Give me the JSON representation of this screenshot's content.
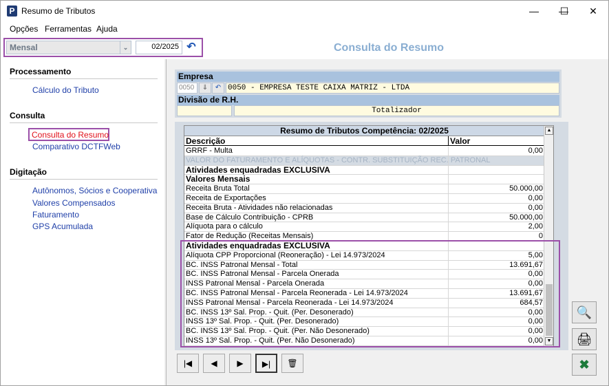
{
  "window": {
    "title": "Resumo de Tributos",
    "icon": "app-p-icon"
  },
  "window_controls": {
    "minimize": "—",
    "maximize": "☐",
    "close": "✕"
  },
  "menu": [
    {
      "label": "Opções",
      "accel": "O"
    },
    {
      "label": "Ferramentas",
      "accel": "F"
    },
    {
      "label": "Ajuda",
      "accel": "A"
    }
  ],
  "toolbar": {
    "period_value": "Mensal",
    "period_arrow": "⌄",
    "date_value": "02/2025",
    "refresh_icon": "↶",
    "page_header": "Consulta do Resumo"
  },
  "sidebar": {
    "sections": [
      {
        "title": "Processamento",
        "items": [
          "Cálculo do Tributo"
        ]
      },
      {
        "title": "Consulta",
        "items": [
          "Consulta do Resumo",
          "Comparativo DCTFWeb"
        ]
      },
      {
        "title": "Digitação",
        "items": [
          "Autônomos, Sócios e Cooperativa",
          "Valores Compensados",
          "Faturamento",
          "GPS Acumulada"
        ]
      }
    ],
    "active_item": "Consulta do Resumo"
  },
  "company": {
    "header": "Empresa",
    "code": "0050",
    "name": "0050 - EMPRESA TESTE CAIXA MATRIZ -  LTDA",
    "division_header": "Divisão de R.H.",
    "division_code": "",
    "division_name": "Totalizador"
  },
  "grid": {
    "title": "Resumo de Tributos Competência: 02/2025",
    "col_desc": "Descrição",
    "col_value": "Valor",
    "rows": [
      {
        "d": "GRRF - Multa",
        "v": "0,00",
        "style": ""
      },
      {
        "d": "VALOR DO FATURAMENTO E ALÍQUOTAS - CONTR. SUBSTITUIÇÃO REC. PATRONAL",
        "v": "",
        "style": "disabled"
      },
      {
        "d": "Atividades enquadradas EXCLUSIVA",
        "v": "",
        "style": "bold"
      },
      {
        "d": "Valores Mensais",
        "v": "",
        "style": "bold"
      },
      {
        "d": "Receita Bruta Total",
        "v": "50.000,00",
        "style": ""
      },
      {
        "d": "Receita de Exportações",
        "v": "0,00",
        "style": ""
      },
      {
        "d": "Receita Bruta - Atividades não relacionadas",
        "v": "0,00",
        "style": ""
      },
      {
        "d": "Base de Cálculo Contribuição - CPRB",
        "v": "50.000,00",
        "style": ""
      },
      {
        "d": "Alíquota para o cálculo",
        "v": "2,00",
        "style": ""
      },
      {
        "d": "Fator de Redução (Receitas Mensais)",
        "v": "0",
        "style": ""
      },
      {
        "d": "Atividades enquadradas EXCLUSIVA",
        "v": "",
        "style": "bold"
      },
      {
        "d": "Alíquota CPP Proporcional (Reoneração) - Lei 14.973/2024",
        "v": "5,00",
        "style": ""
      },
      {
        "d": "BC. INSS Patronal Mensal - Total",
        "v": "13.691,67",
        "style": ""
      },
      {
        "d": "BC. INSS Patronal Mensal - Parcela Onerada",
        "v": "0,00",
        "style": ""
      },
      {
        "d": "INSS Patronal Mensal - Parcela Onerada",
        "v": "0,00",
        "style": ""
      },
      {
        "d": "BC. INSS Patronal Mensal - Parcela Reonerada - Lei 14.973/2024",
        "v": "13.691,67",
        "style": ""
      },
      {
        "d": "INSS Patronal Mensal - Parcela Reonerada - Lei 14.973/2024",
        "v": "684,57",
        "style": ""
      },
      {
        "d": "BC. INSS 13º Sal. Prop. - Quit. (Per. Desonerado)",
        "v": "0,00",
        "style": ""
      },
      {
        "d": "INSS 13º Sal. Prop. - Quit. (Per. Desonerado)",
        "v": "0,00",
        "style": ""
      },
      {
        "d": "BC. INSS 13º Sal. Prop. - Quit. (Per. Não Desonerado)",
        "v": "0,00",
        "style": ""
      },
      {
        "d": "INSS 13º Sal. Prop. - Quit. (Per. Não Desonerado)",
        "v": "0,00",
        "style": ""
      }
    ]
  },
  "navigation": {
    "buttons": [
      {
        "name": "first-record-button",
        "glyph": "|◀"
      },
      {
        "name": "previous-record-button",
        "glyph": "◀"
      },
      {
        "name": "next-record-button",
        "glyph": "▶"
      },
      {
        "name": "last-record-button",
        "glyph": "▶|"
      },
      {
        "name": "delete-button",
        "glyph": "🗑"
      }
    ]
  },
  "side_actions": [
    {
      "name": "search-user-icon",
      "glyph": "🔍"
    },
    {
      "name": "print-icon",
      "glyph": "🖨"
    },
    {
      "name": "exit-excel-icon",
      "glyph": "✖"
    }
  ],
  "colors": {
    "highlight": "#9b4fa8",
    "header_blue": "#8aaed2",
    "link_blue": "#1f3fa8",
    "active_red": "#e0101a",
    "panel_header": "#a9c2de"
  }
}
